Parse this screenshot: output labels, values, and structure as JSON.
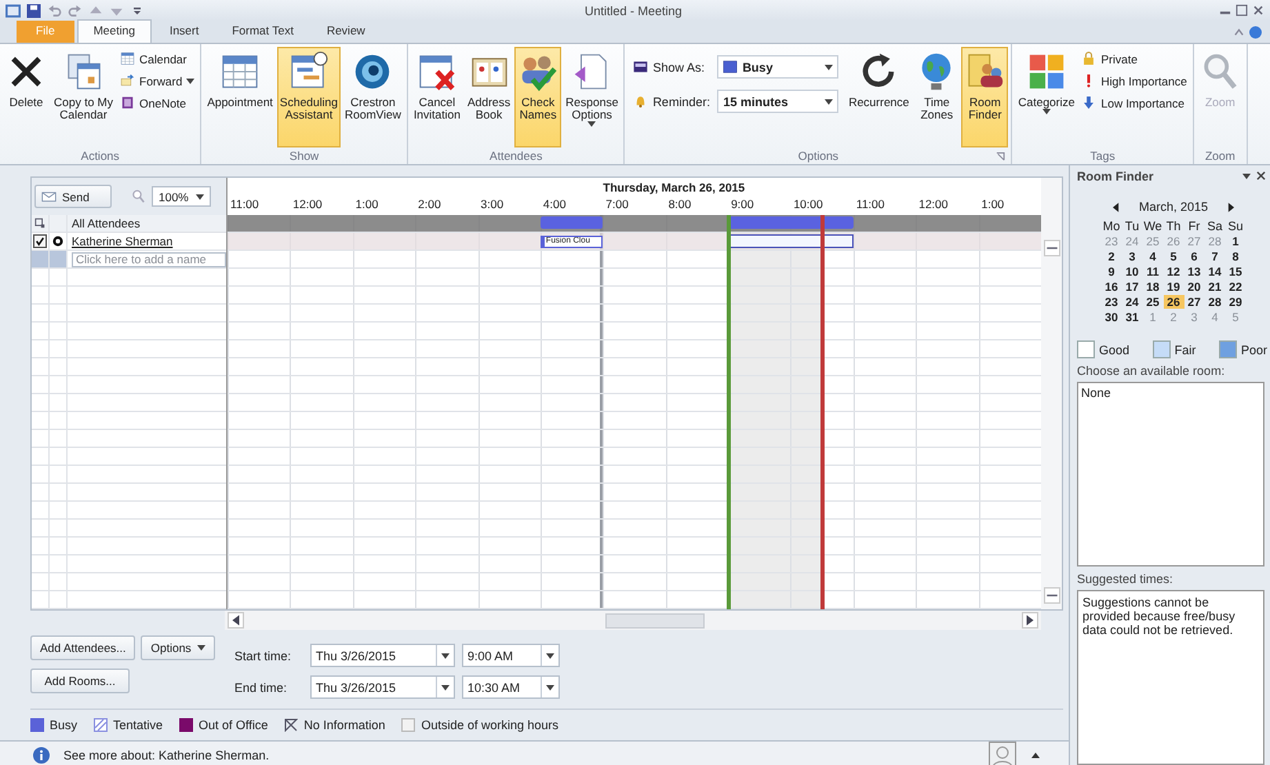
{
  "window": {
    "title": "Untitled - Meeting"
  },
  "tabs": [
    {
      "label": "File",
      "kind": "file",
      "selected": false
    },
    {
      "label": "Meeting",
      "kind": "tab",
      "selected": true
    },
    {
      "label": "Insert",
      "kind": "tab",
      "selected": false
    },
    {
      "label": "Format Text",
      "kind": "tab",
      "selected": false
    },
    {
      "label": "Review",
      "kind": "tab",
      "selected": false
    }
  ],
  "ribbon": [
    {
      "name": "Actions",
      "launcher": false,
      "items": [
        {
          "kind": "large",
          "lines": [
            "Delete"
          ],
          "selected": false,
          "disabled": false,
          "dropdown": false
        },
        {
          "kind": "large",
          "lines": [
            "Copy to My",
            "Calendar"
          ],
          "selected": false,
          "disabled": false,
          "dropdown": false
        },
        {
          "kind": "stack",
          "items": [
            {
              "label": "Calendar",
              "dropdown": false
            },
            {
              "label": "Forward",
              "dropdown": true
            },
            {
              "label": "OneNote",
              "dropdown": false
            }
          ]
        }
      ]
    },
    {
      "name": "Show",
      "launcher": false,
      "items": [
        {
          "kind": "large",
          "lines": [
            "Appointment"
          ],
          "selected": false,
          "disabled": false,
          "dropdown": false
        },
        {
          "kind": "large",
          "lines": [
            "Scheduling",
            "Assistant"
          ],
          "selected": true,
          "disabled": false,
          "dropdown": false
        },
        {
          "kind": "large",
          "lines": [
            "Crestron",
            "RoomView"
          ],
          "selected": false,
          "disabled": false,
          "dropdown": false
        }
      ]
    },
    {
      "name": "Attendees",
      "launcher": false,
      "items": [
        {
          "kind": "large",
          "lines": [
            "Cancel",
            "Invitation"
          ],
          "selected": false,
          "disabled": false,
          "dropdown": false
        },
        {
          "kind": "large",
          "lines": [
            "Address",
            "Book"
          ],
          "selected": false,
          "disabled": false,
          "dropdown": false
        },
        {
          "kind": "large",
          "lines": [
            "Check",
            "Names"
          ],
          "selected": true,
          "disabled": false,
          "dropdown": false
        },
        {
          "kind": "large",
          "lines": [
            "Response",
            "Options"
          ],
          "selected": false,
          "disabled": false,
          "dropdown": true
        }
      ]
    },
    {
      "name": "Options",
      "launcher": true,
      "items": [
        {
          "kind": "fields",
          "items": [
            {
              "label": "Show As:",
              "value": "Busy"
            },
            {
              "label": "Reminder:",
              "value": "15 minutes"
            }
          ]
        },
        {
          "kind": "large",
          "lines": [
            "Recurrence"
          ],
          "selected": false,
          "disabled": false,
          "dropdown": false
        },
        {
          "kind": "large",
          "lines": [
            "Time",
            "Zones"
          ],
          "selected": false,
          "disabled": false,
          "dropdown": false
        },
        {
          "kind": "large",
          "lines": [
            "Room",
            "Finder"
          ],
          "selected": true,
          "disabled": false,
          "dropdown": false
        }
      ]
    },
    {
      "name": "Tags",
      "launcher": false,
      "items": [
        {
          "kind": "large",
          "lines": [
            "Categorize"
          ],
          "selected": false,
          "disabled": false,
          "dropdown": true
        },
        {
          "kind": "stack",
          "items": [
            {
              "label": "Private",
              "dropdown": false
            },
            {
              "label": "High Importance",
              "dropdown": false
            },
            {
              "label": "Low Importance",
              "dropdown": false
            }
          ]
        }
      ]
    },
    {
      "name": "Zoom",
      "launcher": false,
      "items": [
        {
          "kind": "large",
          "lines": [
            "Zoom"
          ],
          "selected": false,
          "disabled": true,
          "dropdown": false
        }
      ]
    }
  ],
  "toolbar": {
    "send": "Send",
    "zoom": "100%"
  },
  "attendees": {
    "header": "All Attendees",
    "placeholder": "Click here to add a name",
    "rows": [
      {
        "name": "Katherine Sherman",
        "checked": true
      }
    ]
  },
  "timeline": {
    "date": "Thursday, March 26, 2015",
    "hours": [
      {
        "label": "11:00",
        "day_end": false,
        "busy": false,
        "meeting": false,
        "start_line": false,
        "end_line": false
      },
      {
        "label": "12:00",
        "day_end": false,
        "busy": false,
        "meeting": false,
        "start_line": false,
        "end_line": false
      },
      {
        "label": "1:00",
        "day_end": false,
        "busy": false,
        "meeting": false,
        "start_line": false,
        "end_line": false
      },
      {
        "label": "2:00",
        "day_end": false,
        "busy": false,
        "meeting": false,
        "start_line": false,
        "end_line": false
      },
      {
        "label": "3:00",
        "day_end": false,
        "busy": false,
        "meeting": false,
        "start_line": false,
        "end_line": false
      },
      {
        "label": "4:00",
        "day_end": true,
        "busy": true,
        "entry": "Fusion Clou",
        "meeting": false,
        "start_line": false,
        "end_line": false
      },
      {
        "label": "7:00",
        "day_end": false,
        "busy": false,
        "meeting": false,
        "start_line": false,
        "end_line": false
      },
      {
        "label": "8:00",
        "day_end": false,
        "busy": false,
        "meeting": false,
        "start_line": false,
        "end_line": false
      },
      {
        "label": "9:00",
        "day_end": false,
        "busy": false,
        "meeting": true,
        "shaded": true,
        "start_line": true,
        "end_line": false
      },
      {
        "label": "10:00",
        "day_end": false,
        "busy": false,
        "meeting": true,
        "shaded": true,
        "start_line": false,
        "end_line": true
      },
      {
        "label": "11:00",
        "day_end": false,
        "busy": false,
        "meeting": false,
        "start_line": false,
        "end_line": false
      },
      {
        "label": "12:00",
        "day_end": false,
        "busy": false,
        "meeting": false,
        "start_line": false,
        "end_line": false
      },
      {
        "label": "1:00",
        "day_end": false,
        "busy": false,
        "meeting": false,
        "start_line": false,
        "end_line": false
      }
    ]
  },
  "buttons": [
    {
      "label": "Add Attendees...",
      "dropdown": false
    },
    {
      "label": "Options",
      "dropdown": true
    },
    {
      "label": "Add Rooms...",
      "dropdown": false
    }
  ],
  "times": [
    {
      "label": "Start time:",
      "date": "Thu 3/26/2015",
      "time": "9:00 AM"
    },
    {
      "label": "End time:",
      "date": "Thu 3/26/2015",
      "time": "10:30 AM"
    }
  ],
  "legend": [
    {
      "label": "Busy",
      "kind": "busy"
    },
    {
      "label": "Tentative",
      "kind": "tentative"
    },
    {
      "label": "Out of Office",
      "kind": "away"
    },
    {
      "label": "No Information",
      "kind": "noinfo"
    },
    {
      "label": "Outside of working hours",
      "kind": "outside"
    }
  ],
  "status_bar": {
    "text": "See more about: Katherine Sherman."
  },
  "room_finder": {
    "title": "Room Finder",
    "month": "March, 2015",
    "weekdays": [
      "Mo",
      "Tu",
      "We",
      "Th",
      "Fr",
      "Sa",
      "Su"
    ],
    "weeks": [
      [
        {
          "d": "23",
          "other": true,
          "selected": false
        },
        {
          "d": "24",
          "other": true,
          "selected": false
        },
        {
          "d": "25",
          "other": true,
          "selected": false
        },
        {
          "d": "26",
          "other": true,
          "selected": false
        },
        {
          "d": "27",
          "other": true,
          "selected": false
        },
        {
          "d": "28",
          "other": true,
          "selected": false
        },
        {
          "d": "1",
          "other": false,
          "selected": false
        }
      ],
      [
        {
          "d": "2",
          "other": false,
          "selected": false
        },
        {
          "d": "3",
          "other": false,
          "selected": false
        },
        {
          "d": "4",
          "other": false,
          "selected": false
        },
        {
          "d": "5",
          "other": false,
          "selected": false
        },
        {
          "d": "6",
          "other": false,
          "selected": false
        },
        {
          "d": "7",
          "other": false,
          "selected": false
        },
        {
          "d": "8",
          "other": false,
          "selected": false
        }
      ],
      [
        {
          "d": "9",
          "other": false,
          "selected": false
        },
        {
          "d": "10",
          "other": false,
          "selected": false
        },
        {
          "d": "11",
          "other": false,
          "selected": false
        },
        {
          "d": "12",
          "other": false,
          "selected": false
        },
        {
          "d": "13",
          "other": false,
          "selected": false
        },
        {
          "d": "14",
          "other": false,
          "selected": false
        },
        {
          "d": "15",
          "other": false,
          "selected": false
        }
      ],
      [
        {
          "d": "16",
          "other": false,
          "selected": false
        },
        {
          "d": "17",
          "other": false,
          "selected": false
        },
        {
          "d": "18",
          "other": false,
          "selected": false
        },
        {
          "d": "19",
          "other": false,
          "selected": false
        },
        {
          "d": "20",
          "other": false,
          "selected": false
        },
        {
          "d": "21",
          "other": false,
          "selected": false
        },
        {
          "d": "22",
          "other": false,
          "selected": false
        }
      ],
      [
        {
          "d": "23",
          "other": false,
          "selected": false
        },
        {
          "d": "24",
          "other": false,
          "selected": false
        },
        {
          "d": "25",
          "other": false,
          "selected": false
        },
        {
          "d": "26",
          "other": false,
          "selected": true
        },
        {
          "d": "27",
          "other": false,
          "selected": false
        },
        {
          "d": "28",
          "other": false,
          "selected": false
        },
        {
          "d": "29",
          "other": false,
          "selected": false
        }
      ],
      [
        {
          "d": "30",
          "other": false,
          "selected": false
        },
        {
          "d": "31",
          "other": false,
          "selected": false
        },
        {
          "d": "1",
          "other": true,
          "selected": false
        },
        {
          "d": "2",
          "other": true,
          "selected": false
        },
        {
          "d": "3",
          "other": true,
          "selected": false
        },
        {
          "d": "4",
          "other": true,
          "selected": false
        },
        {
          "d": "5",
          "other": true,
          "selected": false
        }
      ]
    ],
    "quality": [
      {
        "label": "Good",
        "color": "#ffffff"
      },
      {
        "label": "Fair",
        "color": "#c5dcf7"
      },
      {
        "label": "Poor",
        "color": "#6fa0e0"
      }
    ],
    "rooms_label": "Choose an available room:",
    "rooms": [
      "None"
    ],
    "suggested_label": "Suggested times:",
    "suggested": "Suggestions cannot be provided because free/busy data could not be retrieved."
  }
}
